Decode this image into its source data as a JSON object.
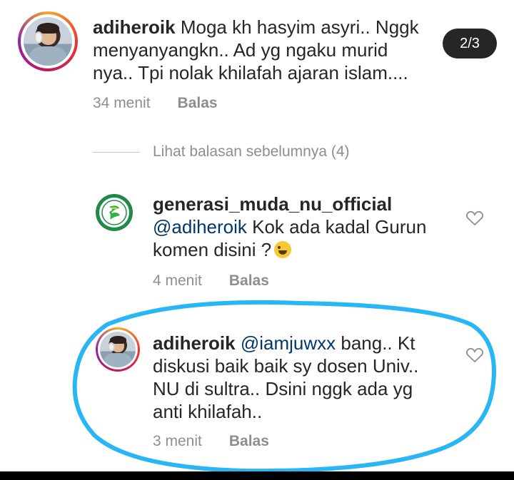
{
  "pager": {
    "label": "2/3"
  },
  "comments": [
    {
      "username": "adiheroik",
      "lines": [
        "Moga kh hasyim asyri.. Nggk",
        "menyanyangkn.. Ad yg ngaku murid",
        "nya.. Tpi nolak khilafah ajaran islam...."
      ],
      "time": "34 menit",
      "reply": "Balas"
    },
    {
      "username": "generasi_muda_nu_official",
      "mention": "@adiheroik",
      "lines": [
        " Kok ada kadal Gurun",
        "komen disini ?"
      ],
      "time": "4 menit",
      "reply": "Balas"
    },
    {
      "username": "adiheroik",
      "mention": "@iamjuwxx",
      "lines": [
        " bang.. Kt",
        "diskusi baik baik sy dosen Univ..",
        "NU di sultra.. Dsini nggk ada yg",
        "anti khilafah.."
      ],
      "time": "3 menit",
      "reply": "Balas"
    }
  ],
  "view_previous": "Lihat balasan sebelumnya (4)",
  "icons": {
    "heart": "heart-outline-icon",
    "emoji": "rolling-laughing-emoji-icon",
    "logo": "nu-logo-icon"
  },
  "colors": {
    "highlight": "#29b6f6",
    "mention": "#00376b",
    "meta": "#8e8e8e"
  }
}
